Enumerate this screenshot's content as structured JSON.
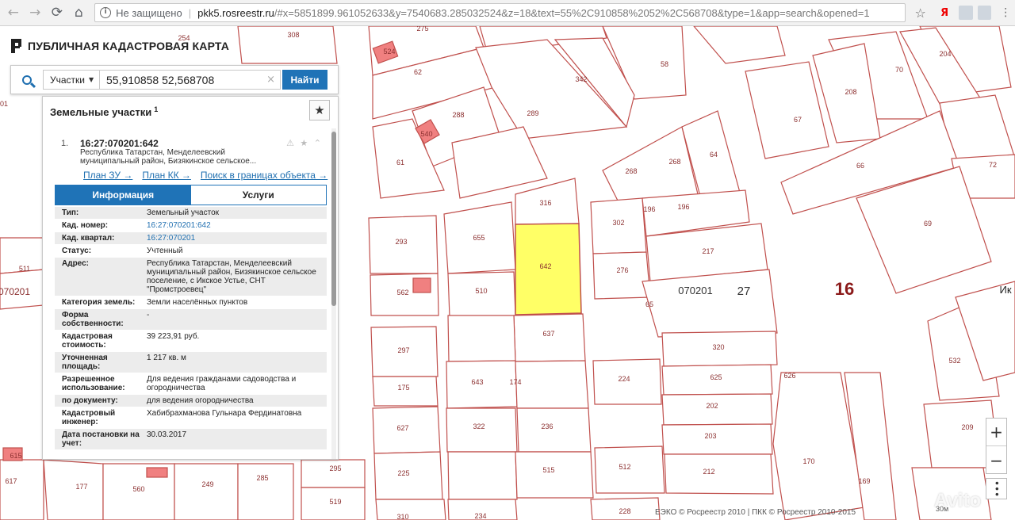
{
  "browser": {
    "nav": {
      "back": "←",
      "forward": "→",
      "reload": "⟳",
      "home": "⌂"
    },
    "security_label": "Не защищено",
    "url_host": "pkk5.rosreestr.ru",
    "url_rest": "/#x=5851899.961052633&y=7540683.285032524&z=18&text=55%2C910858%2052%2C568708&type=1&app=search&opened=1",
    "ext_y": "Я",
    "ext_menu": "⋮"
  },
  "app": {
    "title": "ПУБЛИЧНАЯ КАДАСТРОВАЯ КАРТА"
  },
  "search": {
    "type_label": "Участки",
    "query": "55,910858 52,568708",
    "clear": "×",
    "button": "Найти"
  },
  "results": {
    "heading": "Земельные участки",
    "count": "1",
    "fav": "★",
    "item": {
      "num": "1.",
      "id": "16:27:070201:642",
      "address_short": "Республика Татарстан, Менделеевский муниципальный район, Бизякинское сельское...",
      "actions": "⚠ ★ ⌃",
      "links": [
        "План ЗУ →",
        "План КК →",
        "Поиск в границах объекта →"
      ],
      "tabs": {
        "info": "Информация",
        "services": "Услуги"
      },
      "rows": [
        {
          "k": "Тип:",
          "v": "Земельный участок"
        },
        {
          "k": "Кад. номер:",
          "v": "16:27:070201:642"
        },
        {
          "k": "Кад. квартал:",
          "v": "16:27:070201"
        },
        {
          "k": "Статус:",
          "v": "Учтенный"
        },
        {
          "k": "Адрес:",
          "v": "Республика Татарстан, Менделеевский муниципальный район, Бизякинское сельское поселение, с Икское Устье, СНТ \"Промстроевец\""
        },
        {
          "k": "Категория земель:",
          "v": "Земли населённых пунктов"
        },
        {
          "k": "Форма собственности:",
          "v": "-"
        },
        {
          "k": "Кадастровая стоимость:",
          "v": "39 223,91 руб."
        },
        {
          "k": "Уточненная площадь:",
          "v": "1 217 кв. м"
        },
        {
          "k": "Разрешенное использование:",
          "v": "Для ведения гражданами садоводства и огородничества"
        },
        {
          "k": "по документу:",
          "v": "для ведения огородничества"
        },
        {
          "k": "Кадастровый инженер:",
          "v": "Хабибрахманова Гульнара Фердинатовна"
        },
        {
          "k": "Дата постановки на учет:",
          "v": "30.03.2017"
        }
      ]
    }
  },
  "map": {
    "colors": {
      "parcel_line": "#c0504d",
      "parcel_fill": "#ffffff",
      "selected_fill": "#ffff66",
      "building_fill": "#f08080"
    },
    "labels": [
      "308",
      "254",
      "275",
      "62",
      "342",
      "58",
      "204",
      "70",
      "208",
      "67",
      "72",
      "288",
      "289",
      "66",
      "61",
      "268",
      "268",
      "64",
      "69",
      "316",
      "655",
      "642",
      "302",
      "196",
      "196",
      "217",
      "293",
      "276",
      "562",
      "510",
      "65",
      "070201",
      "27",
      "16",
      "Ик",
      "637",
      "320",
      "297",
      "175",
      "643",
      "174",
      "224",
      "625",
      "532",
      "627",
      "322",
      "236",
      "202",
      "203",
      "209",
      "295",
      "225",
      "515",
      "512",
      "212",
      "170",
      "169",
      "519",
      "310",
      "234",
      "228",
      "177",
      "560",
      "249",
      "285",
      "617",
      "615",
      "511",
      "070201",
      "01",
      "626",
      "524",
      "540"
    ],
    "attribution": "ЕЭКО © Росреестр 2010 | ПКК © Росреестр 2010-2015",
    "scale": "30м",
    "watermark": "Avito",
    "zoom_in": "+",
    "zoom_out": "−",
    "more": "•••"
  }
}
